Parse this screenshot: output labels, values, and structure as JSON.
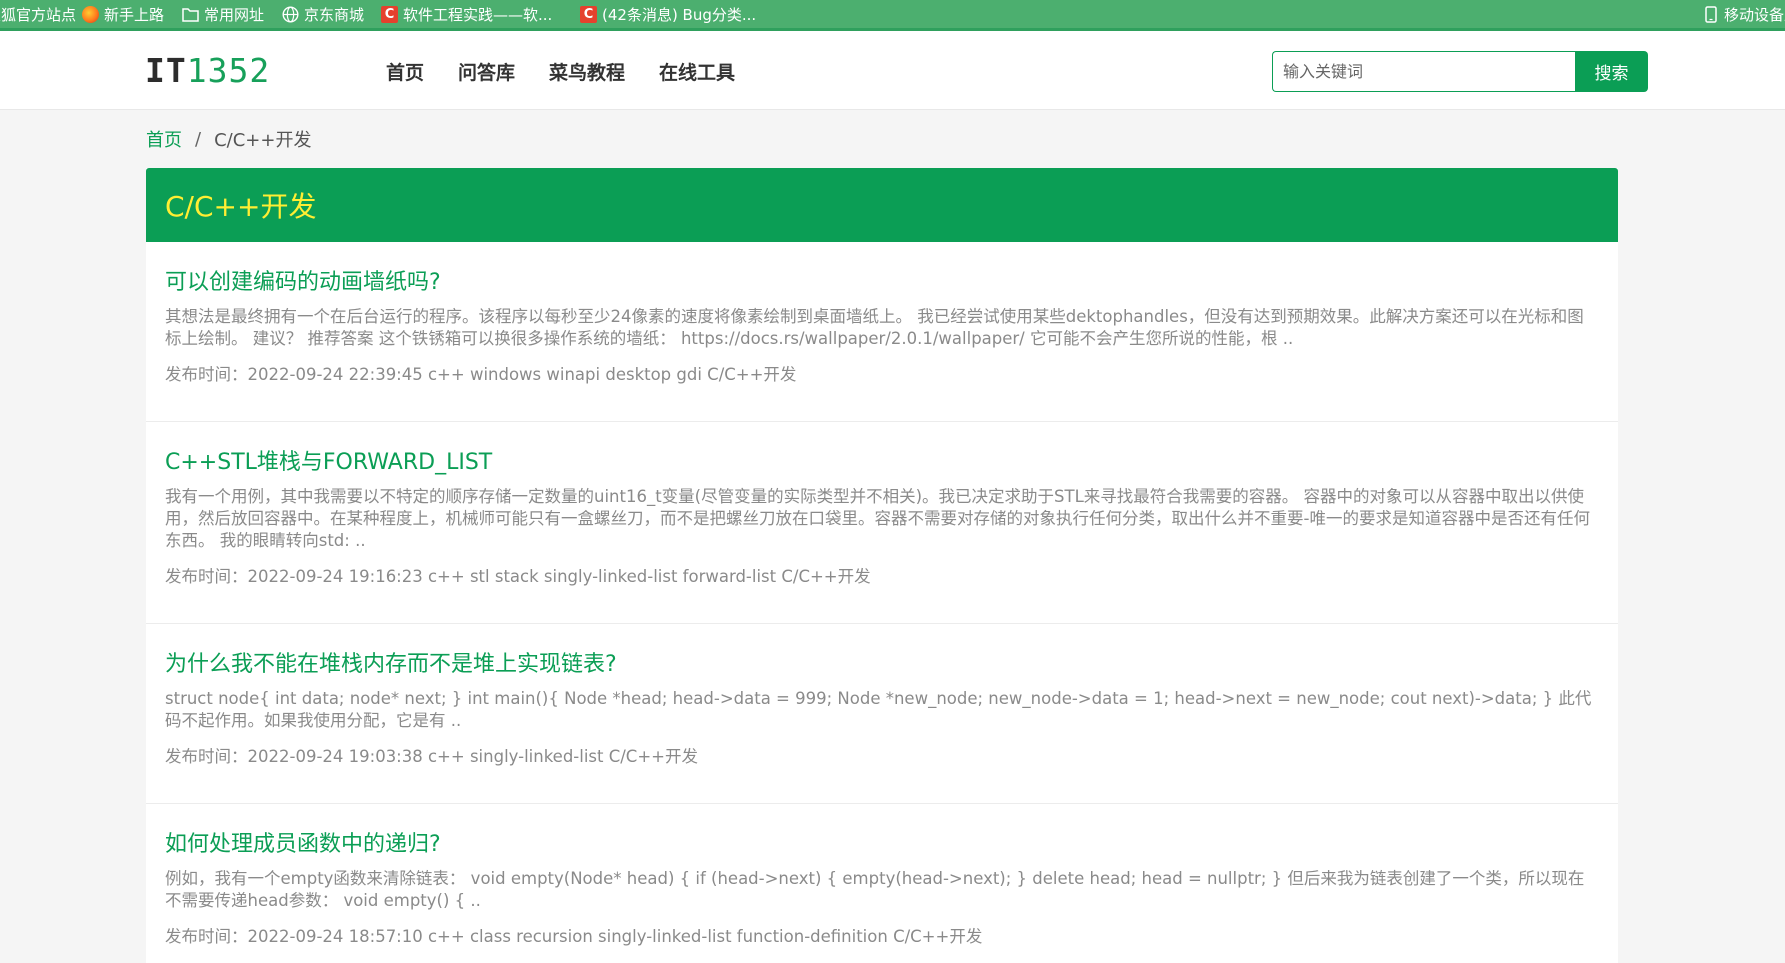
{
  "bookmarks": [
    {
      "label": "火狐官方站点",
      "icon": "firefox-icon"
    },
    {
      "label": "新手上路",
      "icon": "firefox-icon"
    },
    {
      "label": "常用网址",
      "icon": "folder-icon"
    },
    {
      "label": "京东商城",
      "icon": "globe-icon"
    },
    {
      "label": "软件工程实践——软...",
      "icon": "csdn-c-icon"
    },
    {
      "label": "(42条消息) Bug分类...",
      "icon": "csdn-c-icon"
    },
    {
      "label": "移动设备上",
      "icon": "mobile-icon"
    }
  ],
  "header": {
    "logo_it": "IT",
    "logo_num": "1352",
    "nav": [
      "首页",
      "问答库",
      "菜鸟教程",
      "在线工具"
    ],
    "search_placeholder": "输入关键词",
    "search_button": "搜索"
  },
  "breadcrumb": {
    "home": "首页",
    "separator": "/",
    "current": "C/C++开发"
  },
  "category": {
    "title": "C/C++开发"
  },
  "items": [
    {
      "title": "可以创建编码的动画墙纸吗?",
      "desc": "其想法是最终拥有一个在后台运行的程序。该程序以每秒至少24像素的速度将像素绘制到桌面墙纸上。 我已经尝试使用某些dektophandles，但没有达到预期效果。此解决方案还可以在光标和图标上绘制。 建议？ 推荐答案 这个铁锈箱可以换很多操作系统的墙纸： https://docs.rs/wallpaper/2.0.1/wallpaper/ 它可能不会产生您所说的性能，根 ..",
      "meta": "发布时间：2022-09-24 22:39:45 c++ windows winapi desktop gdi C/C++开发"
    },
    {
      "title": "C++STL堆栈与FORWARD_LIST",
      "desc": "我有一个用例，其中我需要以不特定的顺序存储一定数量的uint16_t变量(尽管变量的实际类型并不相关)。我已决定求助于STL来寻找最符合我需要的容器。 容器中的对象可以从容器中取出以供使用，然后放回容器中。在某种程度上，机械师可能只有一盒螺丝刀，而不是把螺丝刀放在口袋里。容器不需要对存储的对象执行任何分类，取出什么并不重要-唯一的要求是知道容器中是否还有任何东西。 我的眼睛转向std: ..",
      "meta": "发布时间：2022-09-24 19:16:23 c++ stl stack singly-linked-list forward-list C/C++开发"
    },
    {
      "title": "为什么我不能在堆栈内存而不是堆上实现链表?",
      "desc": "struct node{ int data; node* next; } int main(){ Node *head; head->data = 999; Node *new_node; new_node->data = 1; head->next = new_node; cout next)->data; } 此代码不起作用。如果我使用分配，它是有 ..",
      "meta": "发布时间：2022-09-24 19:03:38 c++ singly-linked-list C/C++开发"
    },
    {
      "title": "如何处理成员函数中的递归?",
      "desc": "例如，我有一个empty函数来清除链表： void empty(Node* head) { if (head->next) { empty(head->next); } delete head; head = nullptr; } 但后来我为链表创建了一个类，所以现在不需要传递head参数： void empty() { ..",
      "meta": "发布时间：2022-09-24 18:57:10 c++ class recursion singly-linked-list function-definition C/C++开发"
    }
  ]
}
